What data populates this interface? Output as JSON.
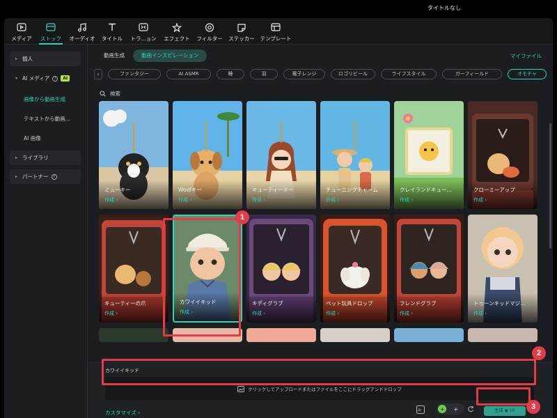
{
  "window": {
    "title": "タイトルなし"
  },
  "toolbar": {
    "items": [
      {
        "label": "メディア",
        "icon": "media-icon"
      },
      {
        "label": "ストック",
        "icon": "stock-icon"
      },
      {
        "label": "オーディオ",
        "icon": "audio-icon"
      },
      {
        "label": "タイトル",
        "icon": "title-icon"
      },
      {
        "label": "トラ...ョン",
        "icon": "transition-icon"
      },
      {
        "label": "エフェクト",
        "icon": "effect-icon"
      },
      {
        "label": "フィルター",
        "icon": "filter-icon"
      },
      {
        "label": "ステッカー",
        "icon": "sticker-icon"
      },
      {
        "label": "テンプレート",
        "icon": "template-icon"
      }
    ],
    "active_index": 1
  },
  "sidebar": {
    "personal": "個人",
    "ai_media": "AI メディア",
    "ai_badge": "AI",
    "sub_items": [
      "画像から動画生成",
      "テキストから動画...",
      "AI 画像"
    ],
    "library": "ライブラリ",
    "partner": "パートナー"
  },
  "top": {
    "tab_generate": "動画生成",
    "tab_inspiration": "動画インスピレーション",
    "my_files": "マイファイル"
  },
  "tags": [
    "ファンタジー",
    "AI ASMR",
    "睡",
    "羽",
    "電子レンジ",
    "ロゴリビール",
    "ライフスタイル",
    "ガーフィールド",
    "オモチャ"
  ],
  "search": {
    "placeholder": "検索"
  },
  "cards": [
    {
      "name": "ミューキー",
      "action": "作成 ›"
    },
    {
      "name": "Woofキー",
      "action": "作成 ›"
    },
    {
      "name": "キューティーキー",
      "action": "作成 ›"
    },
    {
      "name": "チューニングチャーム",
      "action": "作成 ›"
    },
    {
      "name": "クレイランドキュー...",
      "action": "作成 ›"
    },
    {
      "name": "クローミーアップ",
      "action": "作成 ›"
    },
    {
      "name": "キューティーの爪",
      "action": "作成 ›"
    },
    {
      "name": "カワイイキッド",
      "action": "作成 ›"
    },
    {
      "name": "キディグラブ",
      "action": "作成 ›"
    },
    {
      "name": "ペット玩具ドロップ",
      "action": "作成 ›"
    },
    {
      "name": "フレンドグラブ",
      "action": "作成 ›"
    },
    {
      "name": "トゥーンキッドマジ...",
      "action": "作成 ›"
    }
  ],
  "bottom": {
    "selected_name": "カワイイキッド",
    "upload_text": "クリックしてアップロードまたはファイルをここにドラッグアンドドロップ",
    "customize": "カスタマイズ ›",
    "generate": "生成 ◉ 10"
  },
  "markers": [
    "1",
    "2",
    "3"
  ],
  "colors": {
    "accent": "#2ed5b6",
    "annotation": "#e23b4a",
    "ai_badge": "#b6e43c"
  }
}
